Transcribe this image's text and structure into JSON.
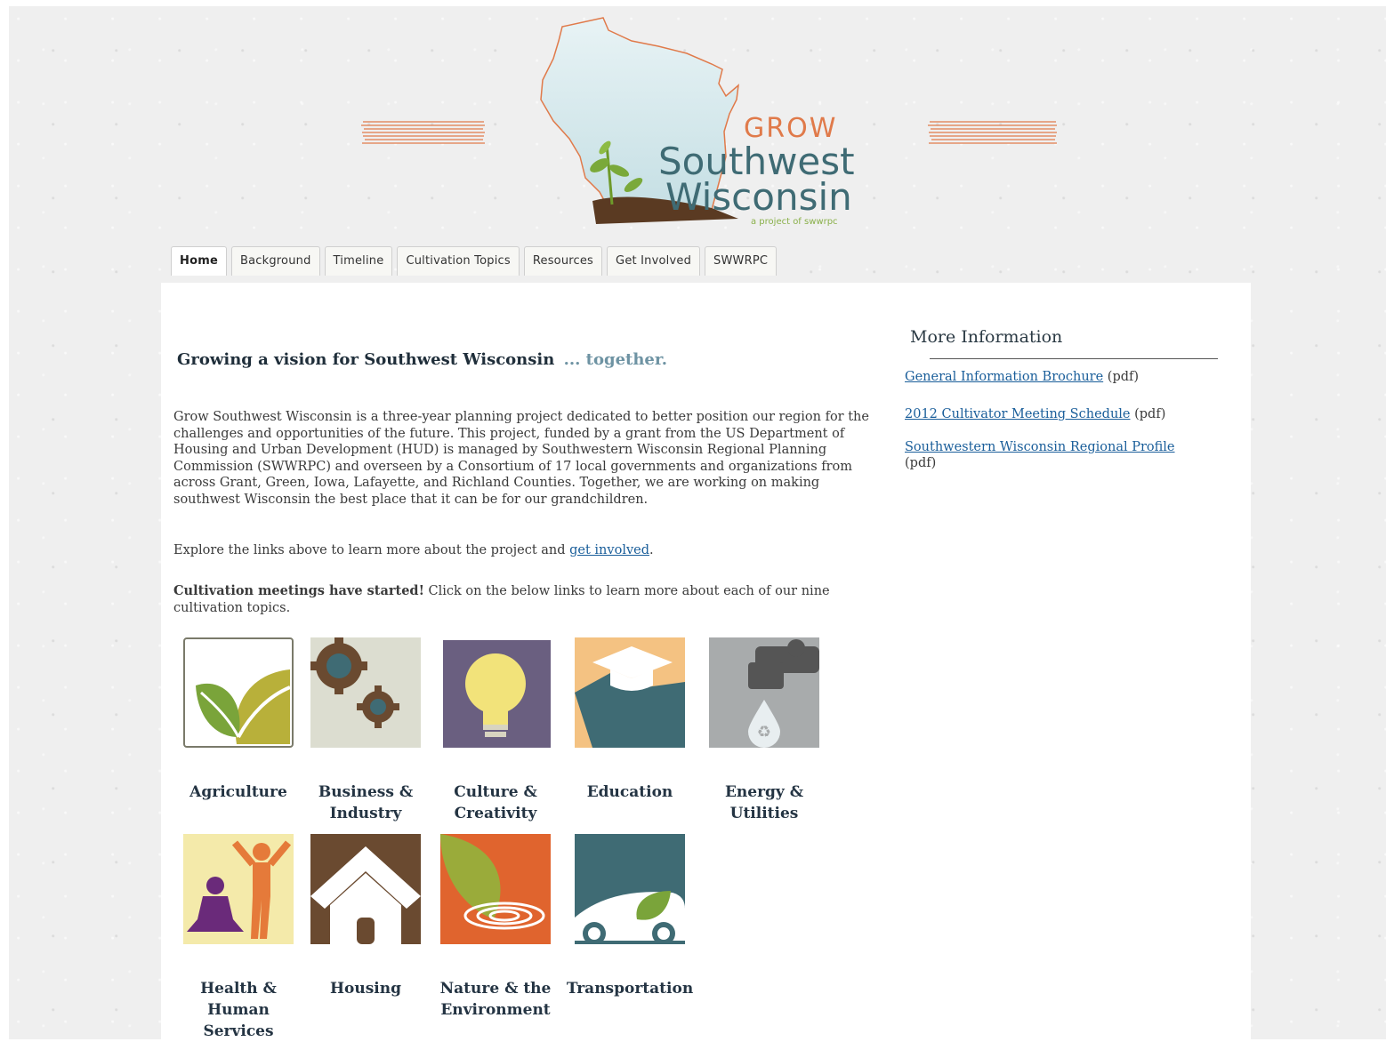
{
  "logo": {
    "line1": "GROW",
    "line2": "Southwest",
    "line3": "Wisconsin",
    "tagline": "a project of swwrpc",
    "icon": "wisconsin-map-sprout-icon"
  },
  "nav": {
    "tabs": [
      {
        "label": "Home"
      },
      {
        "label": "Background"
      },
      {
        "label": "Timeline"
      },
      {
        "label": "Cultivation Topics"
      },
      {
        "label": "Resources"
      },
      {
        "label": "Get Involved"
      },
      {
        "label": "SWWRPC"
      }
    ],
    "active": "Home"
  },
  "main": {
    "headline": "Growing a vision for Southwest Wisconsin",
    "headline_accent": "... together.",
    "intro": "Grow Southwest Wisconsin is a three-year planning project dedicated to better position our region for the challenges and opportunities of the future.  This project, funded by a grant from the US Department of Housing and Urban Development (HUD) is managed by Southwestern Wisconsin Regional Planning Commission  (SWWRPC) and overseen by a Consortium of 17 local governments and organizations from across Grant, Green, Iowa, Lafayette, and Richland Counties.  Together, we are working on  making southwest Wisconsin the best place that it can be for our grandchildren.",
    "explore_before": "Explore the links above to learn more about the project and ",
    "explore_link": "get involved",
    "explore_after": ".",
    "cultivation_bold": "Cultivation meetings have started!",
    "cultivation_rest": "  Click on the below links to learn more about each of our nine cultivation topics."
  },
  "topics": [
    {
      "label": "Agriculture",
      "icon": "leaves-icon"
    },
    {
      "label": "Business & Industry",
      "icon": "gears-icon"
    },
    {
      "label": "Culture & Creativity",
      "icon": "lightbulb-icon"
    },
    {
      "label": "Education",
      "icon": "graduation-cap-icon"
    },
    {
      "label": "Energy & Utilities",
      "icon": "faucet-recycle-icon"
    },
    {
      "label": "Health & Human Services",
      "icon": "people-exercise-icon"
    },
    {
      "label": "Housing",
      "icon": "house-icon"
    },
    {
      "label": "Nature & the Environment",
      "icon": "leaf-ripple-icon"
    },
    {
      "label": "Transportation",
      "icon": "car-leaf-icon"
    }
  ],
  "sidebar": {
    "title": "More Information",
    "links": [
      {
        "text": "General Information Brochure",
        "suffix": " (pdf)"
      },
      {
        "text": "2012 Cultivator Meeting Schedule",
        "suffix": " (pdf)"
      },
      {
        "text": "Southwestern Wisconsin Regional Profile",
        "suffix": " (pdf)"
      }
    ]
  },
  "colors": {
    "accent_orange": "#e07a4a",
    "brand_teal": "#3f6b74",
    "link_blue": "#1a5e9a"
  }
}
